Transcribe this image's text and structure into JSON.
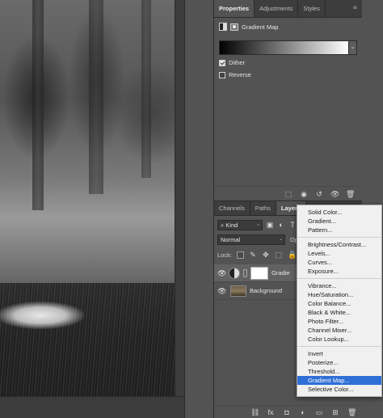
{
  "properties_panel": {
    "tabs": [
      "Properties",
      "Adjustments",
      "Styles"
    ],
    "title": "Gradient Map",
    "dither_label": "Dither",
    "dither_checked": true,
    "reverse_label": "Reverse",
    "reverse_checked": false
  },
  "layers_panel": {
    "tabs": [
      "Channels",
      "Paths",
      "Layers"
    ],
    "filter_kind": "Kind",
    "blend_mode": "Normal",
    "opacity_label": "Opa",
    "lock_label": "Lock:",
    "layers": [
      {
        "name": "Gradie",
        "type": "adjustment",
        "selected": true
      },
      {
        "name": "Background",
        "type": "image",
        "selected": false
      }
    ]
  },
  "adjustment_menu": {
    "groups": [
      [
        "Solid Color...",
        "Gradient...",
        "Pattern..."
      ],
      [
        "Brightness/Contrast...",
        "Levels...",
        "Curves...",
        "Exposure..."
      ],
      [
        "Vibrance...",
        "Hue/Saturation...",
        "Color Balance...",
        "Black & White...",
        "Photo Filter...",
        "Channel Mixer...",
        "Color Lookup..."
      ],
      [
        "Invert",
        "Posterize...",
        "Threshold...",
        "Gradient Map...",
        "Selective Color..."
      ]
    ],
    "highlighted": "Gradient Map..."
  },
  "icons": {
    "panel_menu": "panel-menu-icon",
    "visibility": "eye-icon",
    "fx": "fx-icon"
  },
  "colors": {
    "panel_bg": "#535353",
    "menu_highlight": "#2f6fd6"
  }
}
